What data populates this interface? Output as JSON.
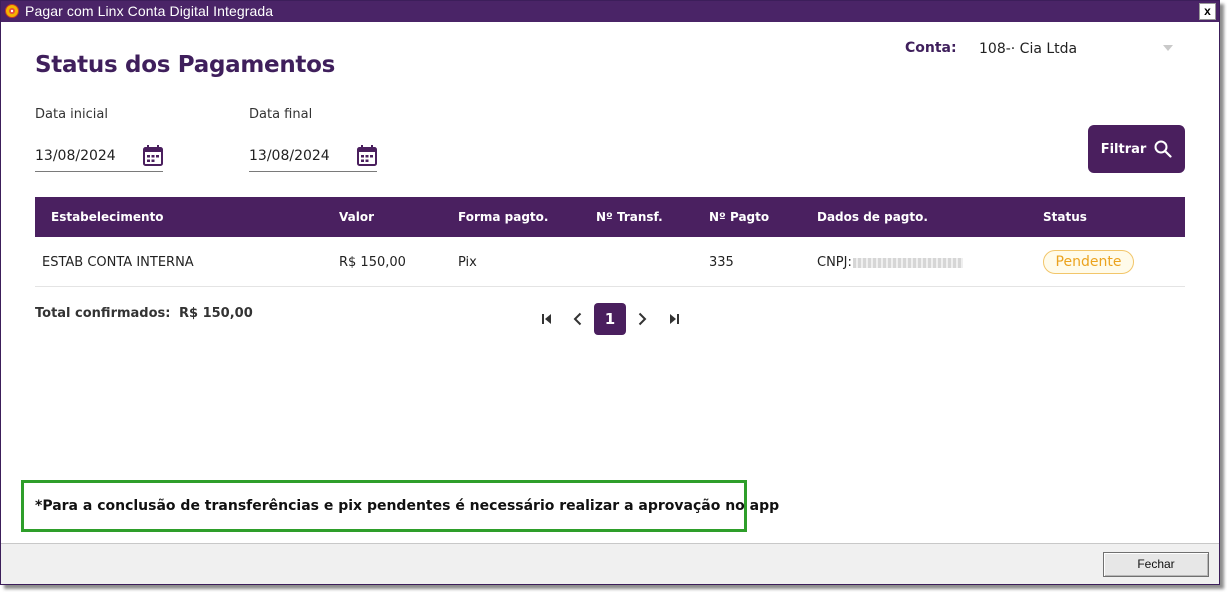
{
  "window": {
    "title": "Pagar com Linx Conta Digital Integrada",
    "close_label": "x"
  },
  "header": {
    "page_title": "Status dos Pagamentos",
    "conta_label": "Conta:",
    "conta_value": "108-· Cia Ltda"
  },
  "filters": {
    "data_inicial_label": "Data inicial",
    "data_inicial_value": "13/08/2024",
    "data_final_label": "Data final",
    "data_final_value": "13/08/2024",
    "filter_button_label": "Filtrar"
  },
  "table": {
    "columns": [
      "Estabelecimento",
      "Valor",
      "Forma pagto.",
      "Nº Transf.",
      "Nº Pagto",
      "Dados de pagto.",
      "Status"
    ],
    "rows": [
      {
        "estabelecimento": "ESTAB CONTA INTERNA",
        "valor": "R$ 150,00",
        "forma_pagto": "Pix",
        "n_transf": "",
        "n_pagto": "335",
        "dados_pagto": "CNPJ:",
        "status": "Pendente"
      }
    ]
  },
  "summary": {
    "total_label": "Total confirmados:",
    "total_value": "R$ 150,00"
  },
  "pagination": {
    "current_page": "1"
  },
  "notice": {
    "text": "*Para a conclusão de transferências e pix pendentes é necessário realizar a aprovação no app"
  },
  "footer": {
    "close_button_label": "Fechar"
  },
  "colors": {
    "primary": "#4a1f5e",
    "status_pending": "#eba31f",
    "notice_border": "#2e9e2a"
  }
}
